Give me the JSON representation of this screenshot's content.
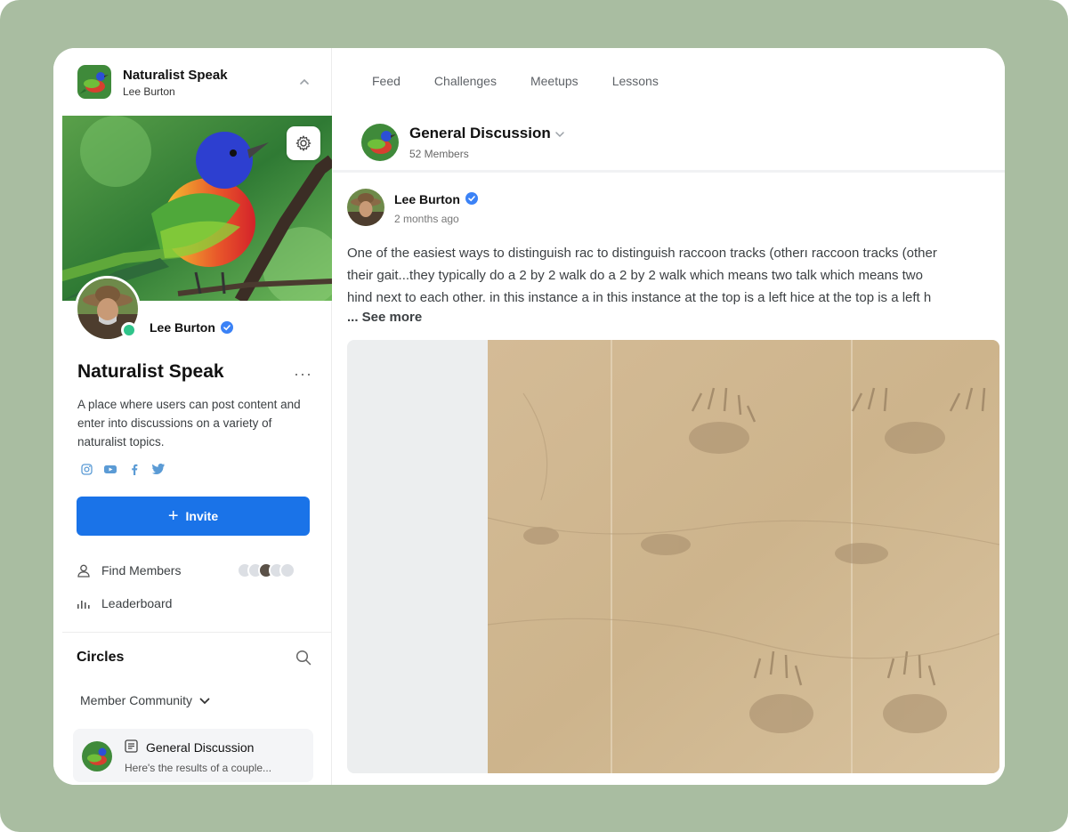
{
  "colors": {
    "backdrop": "#a9bda1",
    "accent": "#1a73e8",
    "online": "#2fc48a",
    "verified": "#3b82f6"
  },
  "sidebar": {
    "app_name": "Naturalist Speak",
    "owner_name": "Lee Burton",
    "user_name": "Lee Burton",
    "community_title": "Naturalist Speak",
    "community_description": "A place where users can post content and enter into discussions on a variety of naturalist topics.",
    "socials": [
      "instagram-icon",
      "youtube-icon",
      "facebook-icon",
      "twitter-icon"
    ],
    "invite_label": "Invite",
    "nav": {
      "find_members": "Find Members",
      "leaderboard": "Leaderboard"
    },
    "circles_title": "Circles",
    "member_community_label": "Member Community",
    "circle_item": {
      "title": "General Discussion",
      "snippet": "Here's the results of a couple..."
    }
  },
  "main": {
    "tabs": [
      "Feed",
      "Challenges",
      "Meetups",
      "Lessons"
    ],
    "group": {
      "title": "General Discussion",
      "members": "52 Members"
    },
    "post": {
      "author": "Lee Burton",
      "time": "2 months ago",
      "body_lines": [
        "One of the easiest ways to distinguish rac to distinguish raccoon tracks (otherı raccoon tracks (other",
        "their gait...they typically do a 2 by 2 walk do a 2 by 2 walk which means two talk which means two",
        "hind next to each other.  in this instance a in this instance at the top is a left hice at the top is a left h"
      ],
      "see_more": "... See more"
    }
  }
}
